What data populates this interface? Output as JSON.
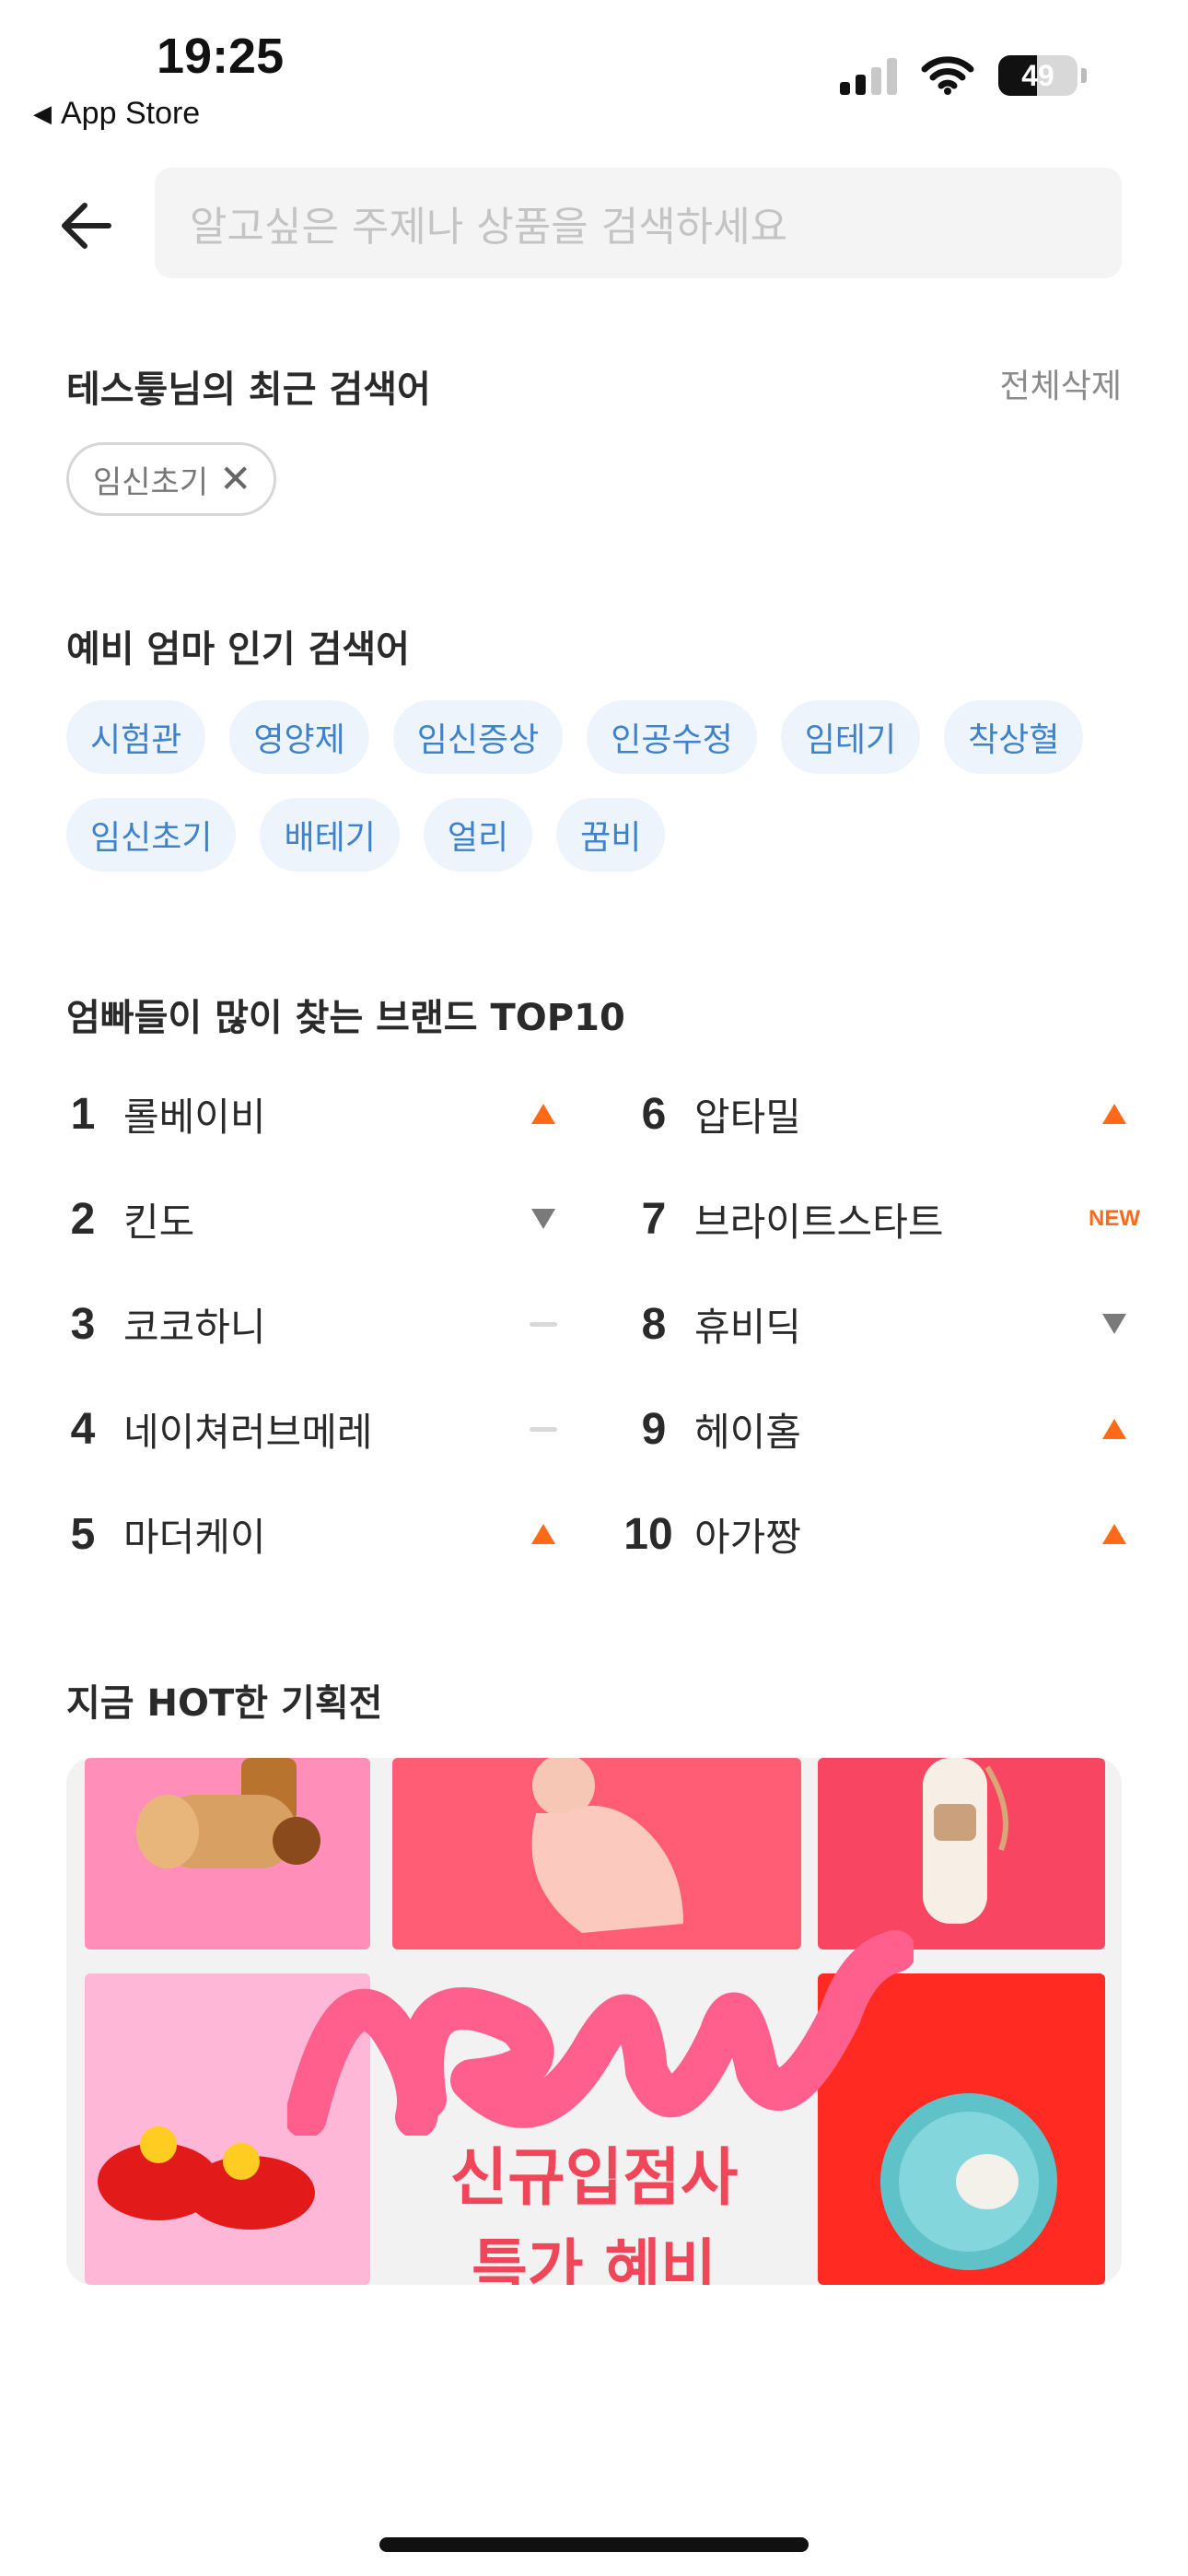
{
  "status_bar": {
    "time": "19:25",
    "back_app": "App Store",
    "battery_level": "49",
    "battery_fraction": 0.49,
    "signal_bars": 2
  },
  "search": {
    "placeholder": "알고싶은 주제나 상품을 검색하세요"
  },
  "recent": {
    "title": "테스틓님의 최근 검색어",
    "delete_all": "전체삭제",
    "items": [
      "임신초기"
    ]
  },
  "popular": {
    "title": "예비 엄마 인기 검색어",
    "items": [
      "시험관",
      "영양제",
      "임신증상",
      "인공수정",
      "임테기",
      "착상혈",
      "임신초기",
      "배테기",
      "얼리",
      "꿈비"
    ]
  },
  "brands": {
    "title": "엄빠들이 많이 찾는 브랜드 TOP10",
    "left": [
      {
        "rank": "1",
        "name": "롤베이비",
        "trend": "up"
      },
      {
        "rank": "2",
        "name": "킨도",
        "trend": "down"
      },
      {
        "rank": "3",
        "name": "코코하니",
        "trend": "same"
      },
      {
        "rank": "4",
        "name": "네이쳐러브메레",
        "trend": "same"
      },
      {
        "rank": "5",
        "name": "마더케이",
        "trend": "up"
      }
    ],
    "right": [
      {
        "rank": "6",
        "name": "압타밀",
        "trend": "up"
      },
      {
        "rank": "7",
        "name": "브라이트스타트",
        "trend": "new",
        "badge": "NEW"
      },
      {
        "rank": "8",
        "name": "휴비딕",
        "trend": "down"
      },
      {
        "rank": "9",
        "name": "헤이홈",
        "trend": "up"
      },
      {
        "rank": "10",
        "name": "아가짱",
        "trend": "up"
      }
    ]
  },
  "hot": {
    "title": "지금 HOT한 기획전",
    "banner_word": "new",
    "banner_title": "신규입점사",
    "banner_sub": "특가 혜비"
  },
  "colors": {
    "accent_orange": "#ff6a1a",
    "chip_blue_text": "#3e82cc",
    "chip_blue_bg": "#edf4fb",
    "banner_pink": "#f0465a"
  }
}
